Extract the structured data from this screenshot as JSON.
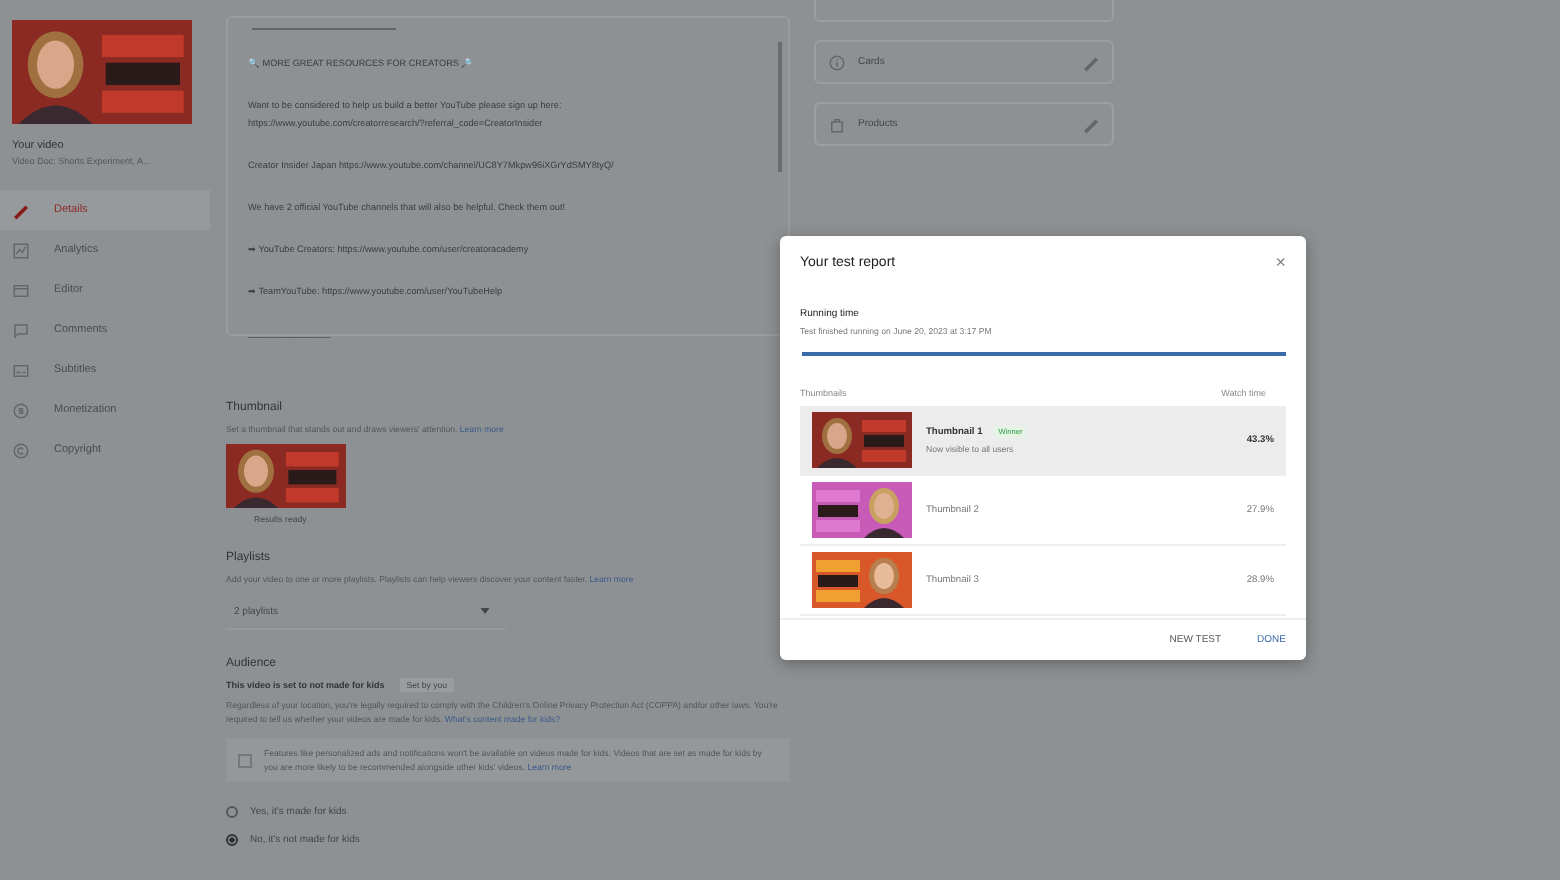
{
  "sidebar": {
    "label": "Your video",
    "video_title": "Video Doc: Shorts Experiment, A...",
    "items": [
      {
        "label": "Details",
        "selected": true
      },
      {
        "label": "Analytics",
        "selected": false
      },
      {
        "label": "Editor",
        "selected": false
      },
      {
        "label": "Comments",
        "selected": false
      },
      {
        "label": "Subtitles",
        "selected": false
      },
      {
        "label": "Monetization",
        "selected": false
      },
      {
        "label": "Copyright",
        "selected": false
      }
    ]
  },
  "description": {
    "lines": [
      "🔍 MORE GREAT RESOURCES FOR CREATORS 🔎",
      "Want to be considered to help us build a better YouTube please sign up here:\nhttps://www.youtube.com/creatorresearch/?referral_code=CreatorInsider",
      "Creator Insider Japan https://www.youtube.com/channel/UC8Y7Mkpw96iXGrYdSMY8tyQ/",
      "We have 2 official YouTube channels that will also be helpful. Check them out!",
      "➡ YouTube Creators: https://www.youtube.com/user/creatoracademy",
      "➡ TeamYouTube: https://www.youtube.com/user/YouTubeHelp",
      "________________"
    ]
  },
  "thumbnail": {
    "title": "Thumbnail",
    "text": "Set a thumbnail that stands out and draws viewers' attention.",
    "link": "Learn more",
    "caption": "Results ready"
  },
  "playlists": {
    "title": "Playlists",
    "text": "Add your video to one or more playlists. Playlists can help viewers discover your content faster.",
    "link": "Learn more",
    "value": "2 playlists"
  },
  "audience": {
    "title": "Audience",
    "status": "This video is set to not made for kids",
    "status_tag": "Set by you",
    "text": "Regardless of your location, you're legally required to comply with the Children's Online Privacy Protection Act (COPPA) and/or other laws. You're required to tell us whether your videos are made for kids.",
    "link": "What's content made for kids?",
    "note": {
      "checked": false,
      "text": "Features like personalized ads and notifications won't be available on videos made for kids. Videos that are set as made for kids by you are more likely to be recommended alongside other kids' videos.",
      "link": "Learn more"
    },
    "options": [
      {
        "label": "Yes, it's made for kids",
        "selected": false
      },
      {
        "label": "No, it's not made for kids",
        "selected": true
      }
    ]
  },
  "right_panel": {
    "items": [
      {
        "label": "Cards"
      },
      {
        "label": "Products"
      }
    ]
  },
  "dialog": {
    "title": "Your test report",
    "close": "×",
    "section": "Running time",
    "subtitle": "Test finished running on June 20, 2023 at 3:17 PM",
    "progress": {
      "level": 1
    },
    "columns": [
      "Thumbnails",
      "Watch time"
    ],
    "rows": [
      {
        "name": "Thumbnail 1",
        "badge": "Winner",
        "note": "Now visible to all users",
        "watch_time": "43.3%",
        "selected": true
      },
      {
        "name": "Thumbnail 2",
        "watch_time": "27.9%",
        "selected": false
      },
      {
        "name": "Thumbnail 3",
        "watch_time": "28.9%",
        "selected": false
      }
    ],
    "buttons": [
      "NEW TEST",
      "DONE"
    ]
  }
}
